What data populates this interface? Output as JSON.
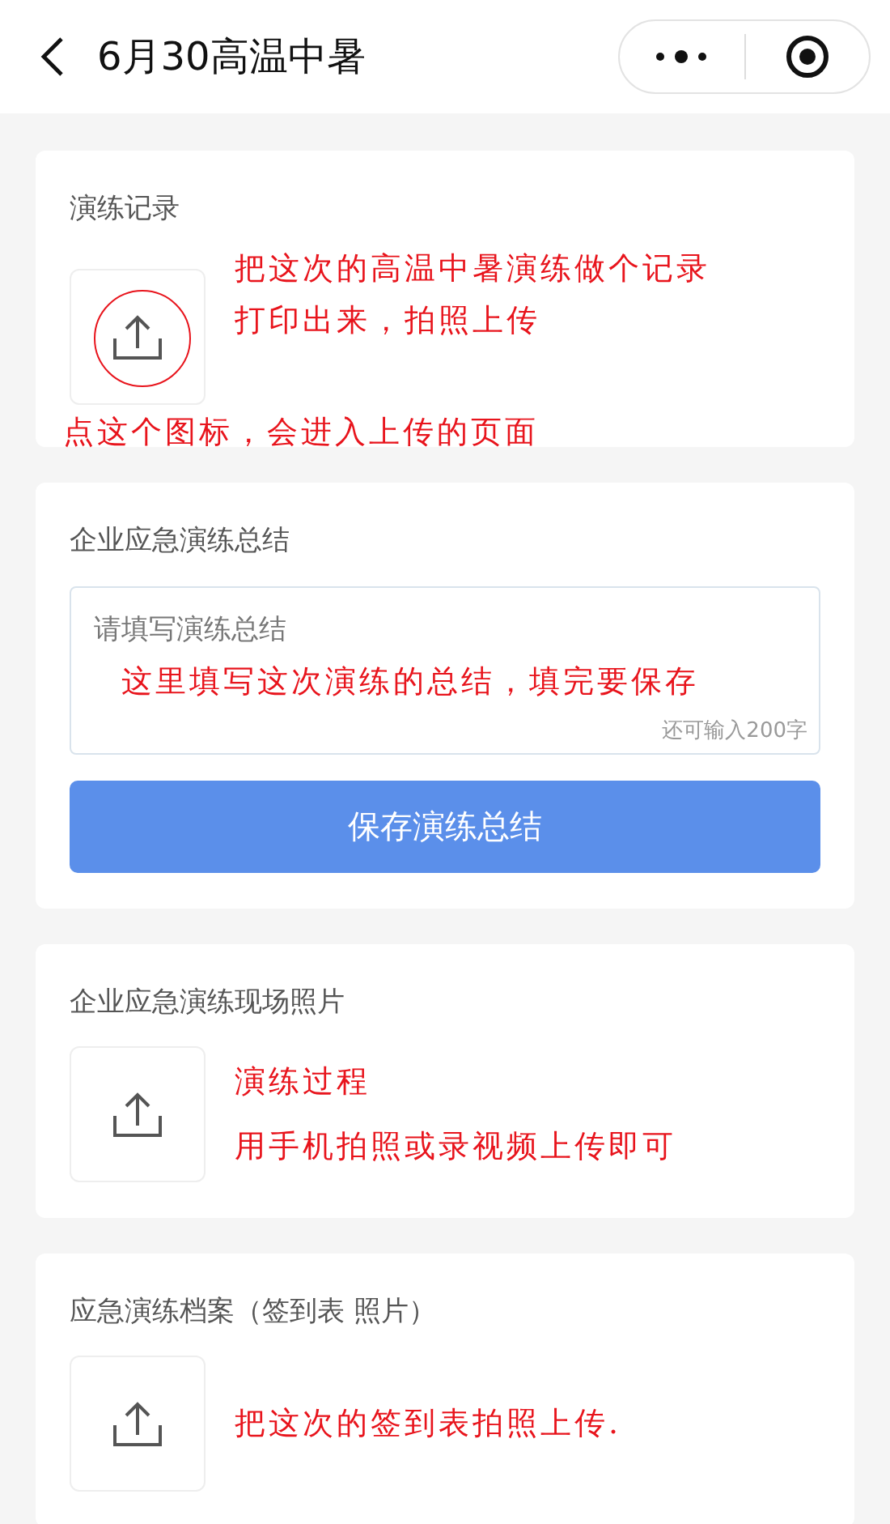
{
  "nav": {
    "title": "6月30高温中暑"
  },
  "sections": [
    {
      "kind": "upload",
      "label": "演练记录",
      "highlighted": true,
      "annotations": [
        {
          "kind": "side",
          "text": "把这次的高温中暑演练做个记录"
        },
        {
          "kind": "side",
          "text": "打印出来，拍照上传"
        },
        {
          "kind": "below",
          "text": "点这个图标，会进入上传的页面"
        }
      ]
    },
    {
      "kind": "summary",
      "label": "企业应急演练总结",
      "placeholder": "请填写演练总结",
      "counter": "还可输入200字",
      "button": "保存演练总结",
      "annotations": [
        {
          "kind": "field",
          "text": "这里填写这次演练的总结，填完要保存"
        }
      ]
    },
    {
      "kind": "upload",
      "label": "企业应急演练现场照片",
      "highlighted": false,
      "annotations": [
        {
          "kind": "side",
          "text": "演练过程"
        },
        {
          "kind": "side",
          "text": "用手机拍照或录视频上传即可"
        }
      ]
    },
    {
      "kind": "upload",
      "label": "应急演练档案（签到表 照片）",
      "highlighted": false,
      "annotations": [
        {
          "kind": "side",
          "text": "把这次的签到表拍照上传."
        }
      ]
    }
  ]
}
